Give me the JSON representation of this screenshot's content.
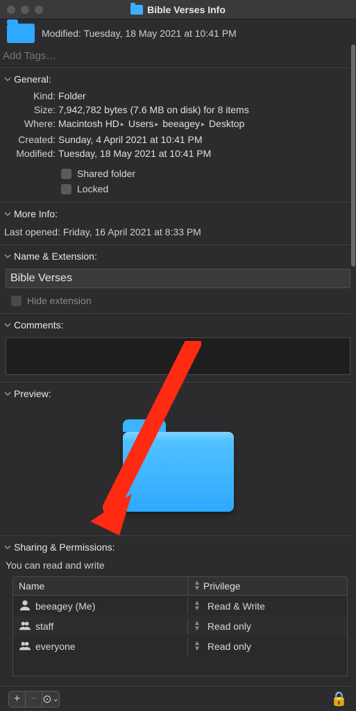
{
  "window": {
    "title": "Bible Verses  Info"
  },
  "header": {
    "modified_label": "Modified:",
    "modified_value": "Tuesday, 18 May 2021 at 10:41 PM"
  },
  "tags": {
    "placeholder": "Add Tags…"
  },
  "sections": {
    "general": "General:",
    "more_info": "More Info:",
    "name_ext": "Name & Extension:",
    "comments": "Comments:",
    "preview": "Preview:",
    "sharing": "Sharing & Permissions:"
  },
  "general": {
    "kind_label": "Kind:",
    "kind_value": "Folder",
    "size_label": "Size:",
    "size_value": "7,942,782 bytes (7.6 MB on disk) for 8 items",
    "where_label": "Where:",
    "where_parts": [
      "Macintosh HD",
      "Users",
      "beeagey",
      "Desktop"
    ],
    "created_label": "Created:",
    "created_value": "Sunday, 4 April 2021 at 10:41 PM",
    "modified_label": "Modified:",
    "modified_value": "Tuesday, 18 May 2021 at 10:41 PM",
    "shared_folder": "Shared folder",
    "locked": "Locked"
  },
  "more_info": {
    "last_opened_label": "Last opened:",
    "last_opened_value": "Friday, 16 April 2021 at 8:33 PM"
  },
  "name_ext": {
    "value": "Bible Verses",
    "hide_extension": "Hide extension"
  },
  "sharing": {
    "summary": "You can read and write",
    "col_name": "Name",
    "col_priv": "Privilege",
    "rows": [
      {
        "name": "beeagey (Me)",
        "priv": "Read & Write",
        "icon": "person"
      },
      {
        "name": "staff",
        "priv": "Read only",
        "icon": "group"
      },
      {
        "name": "everyone",
        "priv": "Read only",
        "icon": "group"
      }
    ]
  },
  "footer": {
    "add": "+",
    "remove": "−",
    "action": "⊙",
    "chev": "⌄"
  }
}
